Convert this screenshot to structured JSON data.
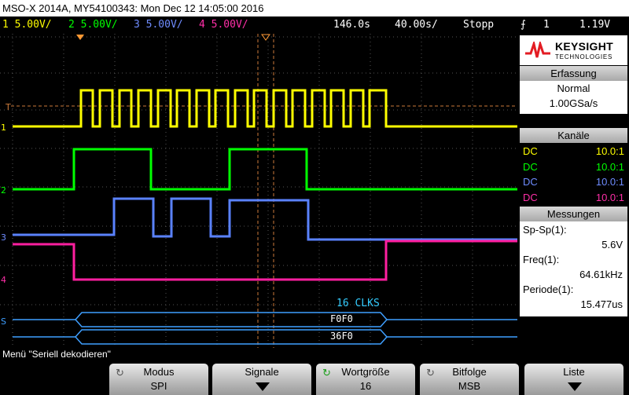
{
  "title": "MSO-X 2014A, MY54100343: Mon Dec 12 14:05:00 2016",
  "status": {
    "ch1": "1  5.00V/",
    "ch2": "2  5.00V/",
    "ch3": "3  5.00V/",
    "ch4": "4  5.00V/",
    "delay": "146.0s",
    "timebase": "40.00s/",
    "run_state": "Stopp",
    "trigger_src": "1",
    "trigger_level": "1.19V",
    "trigger_icon": "trigger-edge-icon"
  },
  "colors": {
    "ch1": "#ffff00",
    "ch2": "#00ff00",
    "ch3": "#5a82ff",
    "ch4": "#ff1fa0",
    "bus": "#3f9fff",
    "clks": "#33ccff",
    "marker": "#ff9933"
  },
  "logo": {
    "brand": "KEYSIGHT",
    "sub": "TECHNOLOGIES"
  },
  "erfassung": {
    "header": "Erfassung",
    "mode": "Normal",
    "rate": "1.00GSa/s"
  },
  "kanaele": {
    "header": "Kanäle",
    "rows": [
      {
        "coupling": "DC",
        "probe": "10.0:1"
      },
      {
        "coupling": "DC",
        "probe": "10.0:1"
      },
      {
        "coupling": "DC",
        "probe": "10.0:1"
      },
      {
        "coupling": "DC",
        "probe": "10.0:1"
      }
    ]
  },
  "messungen": {
    "header": "Messungen",
    "items": [
      {
        "label": "Sp-Sp(1):",
        "value": "5.6V"
      },
      {
        "label": "Freq(1):",
        "value": "64.61kHz"
      },
      {
        "label": "Periode(1):",
        "value": "15.477us"
      }
    ]
  },
  "bus": {
    "clk_label": "16 CLKS",
    "row1": "F0F0",
    "row2": "36F0",
    "label": "S1"
  },
  "channel_markers": [
    "1",
    "2",
    "3",
    "4"
  ],
  "trigger_marker": "T",
  "menu_title": "Menü \"Seriell dekodieren\"",
  "softkeys": [
    {
      "title": "Modus",
      "value": "SPI"
    },
    {
      "title": "Signale",
      "value": ""
    },
    {
      "title": "Wortgröße",
      "value": "16"
    },
    {
      "title": "Bitfolge",
      "value": "MSB"
    },
    {
      "title": "Liste",
      "value": ""
    }
  ]
}
